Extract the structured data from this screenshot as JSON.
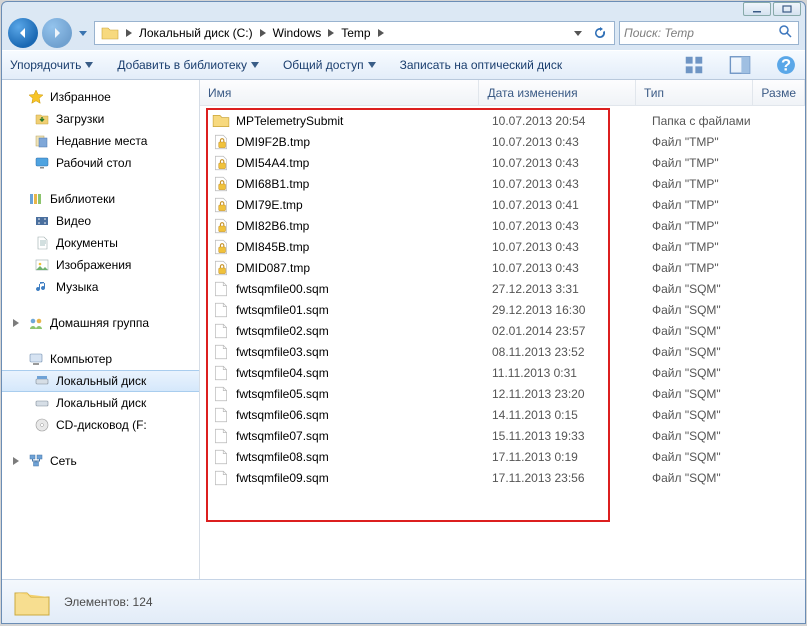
{
  "breadcrumb": {
    "parts": [
      "Локальный диск (C:)",
      "Windows",
      "Temp"
    ]
  },
  "search": {
    "placeholder": "Поиск: Temp"
  },
  "toolbar": {
    "organize": "Упорядочить",
    "addlib": "Добавить в библиотеку",
    "share": "Общий доступ",
    "burn": "Записать на оптический диск"
  },
  "nav": {
    "favorites": {
      "hdr": "Избранное",
      "items": [
        "Загрузки",
        "Недавние места",
        "Рабочий стол"
      ]
    },
    "libraries": {
      "hdr": "Библиотеки",
      "items": [
        "Видео",
        "Документы",
        "Изображения",
        "Музыка"
      ]
    },
    "homegroup": {
      "hdr": "Домашняя группа"
    },
    "computer": {
      "hdr": "Компьютер",
      "items": [
        "Локальный диск",
        "Локальный диск",
        "CD-дисковод (F:"
      ]
    },
    "network": {
      "hdr": "Сеть"
    }
  },
  "cols": {
    "name": "Имя",
    "date": "Дата изменения",
    "type": "Тип",
    "size": "Разме"
  },
  "files": [
    {
      "icon": "folder",
      "name": "MPTelemetrySubmit",
      "date": "10.07.2013 20:54",
      "type": "Папка с файлами"
    },
    {
      "icon": "lock",
      "name": "DMI9F2B.tmp",
      "date": "10.07.2013 0:43",
      "type": "Файл \"TMP\""
    },
    {
      "icon": "lock",
      "name": "DMI54A4.tmp",
      "date": "10.07.2013 0:43",
      "type": "Файл \"TMP\""
    },
    {
      "icon": "lock",
      "name": "DMI68B1.tmp",
      "date": "10.07.2013 0:43",
      "type": "Файл \"TMP\""
    },
    {
      "icon": "lock",
      "name": "DMI79E.tmp",
      "date": "10.07.2013 0:41",
      "type": "Файл \"TMP\""
    },
    {
      "icon": "lock",
      "name": "DMI82B6.tmp",
      "date": "10.07.2013 0:43",
      "type": "Файл \"TMP\""
    },
    {
      "icon": "lock",
      "name": "DMI845B.tmp",
      "date": "10.07.2013 0:43",
      "type": "Файл \"TMP\""
    },
    {
      "icon": "lock",
      "name": "DMID087.tmp",
      "date": "10.07.2013 0:43",
      "type": "Файл \"TMP\""
    },
    {
      "icon": "file",
      "name": "fwtsqmfile00.sqm",
      "date": "27.12.2013 3:31",
      "type": "Файл \"SQM\""
    },
    {
      "icon": "file",
      "name": "fwtsqmfile01.sqm",
      "date": "29.12.2013 16:30",
      "type": "Файл \"SQM\""
    },
    {
      "icon": "file",
      "name": "fwtsqmfile02.sqm",
      "date": "02.01.2014 23:57",
      "type": "Файл \"SQM\""
    },
    {
      "icon": "file",
      "name": "fwtsqmfile03.sqm",
      "date": "08.11.2013 23:52",
      "type": "Файл \"SQM\""
    },
    {
      "icon": "file",
      "name": "fwtsqmfile04.sqm",
      "date": "11.11.2013 0:31",
      "type": "Файл \"SQM\""
    },
    {
      "icon": "file",
      "name": "fwtsqmfile05.sqm",
      "date": "12.11.2013 23:20",
      "type": "Файл \"SQM\""
    },
    {
      "icon": "file",
      "name": "fwtsqmfile06.sqm",
      "date": "14.11.2013 0:15",
      "type": "Файл \"SQM\""
    },
    {
      "icon": "file",
      "name": "fwtsqmfile07.sqm",
      "date": "15.11.2013 19:33",
      "type": "Файл \"SQM\""
    },
    {
      "icon": "file",
      "name": "fwtsqmfile08.sqm",
      "date": "17.11.2013 0:19",
      "type": "Файл \"SQM\""
    },
    {
      "icon": "file",
      "name": "fwtsqmfile09.sqm",
      "date": "17.11.2013 23:56",
      "type": "Файл \"SQM\""
    }
  ],
  "status": {
    "text": "Элементов: 124"
  }
}
